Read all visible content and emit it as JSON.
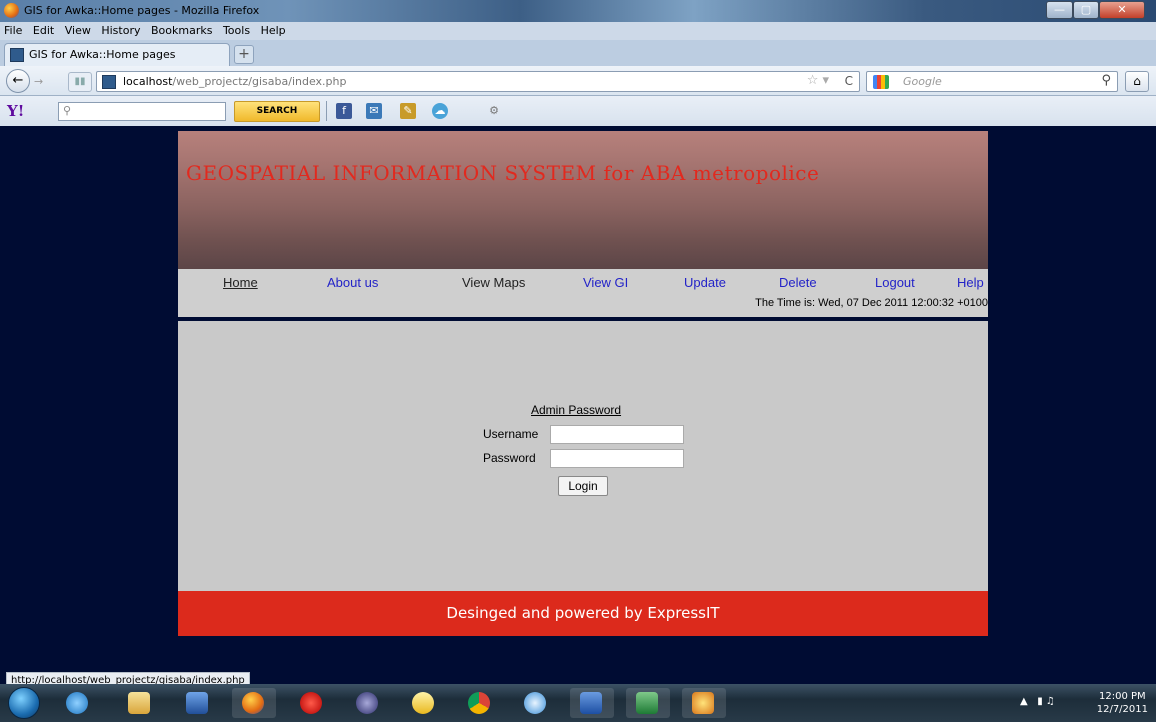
{
  "window": {
    "title": "GIS for Awka::Home pages - Mozilla Firefox",
    "min": "—",
    "max": "▢",
    "close": "✕"
  },
  "menu": [
    "File",
    "Edit",
    "View",
    "History",
    "Bookmarks",
    "Tools",
    "Help"
  ],
  "tab": {
    "label": "GIS for Awka::Home pages",
    "new_tab": "+"
  },
  "nav": {
    "url_host": "localhost",
    "url_path": "/web_projectz/gisaba/index.php",
    "search_placeholder": "Google"
  },
  "yahoo": {
    "logo": "Y!",
    "search_button": "SEARCH"
  },
  "site": {
    "banner_title": "GEOSPATIAL INFORMATION SYSTEM for ABA metropolice",
    "nav_links": [
      "Home",
      "About us",
      "View Maps",
      "View GI",
      "Update",
      "Delete",
      "Logout",
      "Help"
    ],
    "time_text": "The Time is: Wed, 07 Dec 2011 12:00:32 +0100",
    "login": {
      "title": "Admin Password",
      "username_label": "Username",
      "password_label": "Password",
      "button": "Login"
    },
    "footer": "Desinged and powered by ExpressIT"
  },
  "status_url": "http://localhost/web_projectz/gisaba/index.php",
  "clock": {
    "time": "12:00 PM",
    "date": "12/7/2011"
  },
  "colors": {
    "page_bg": "#000c33",
    "banner_title": "#e2291e",
    "footer_bg": "#dc2a1c",
    "link_blue": "#2323c8"
  }
}
